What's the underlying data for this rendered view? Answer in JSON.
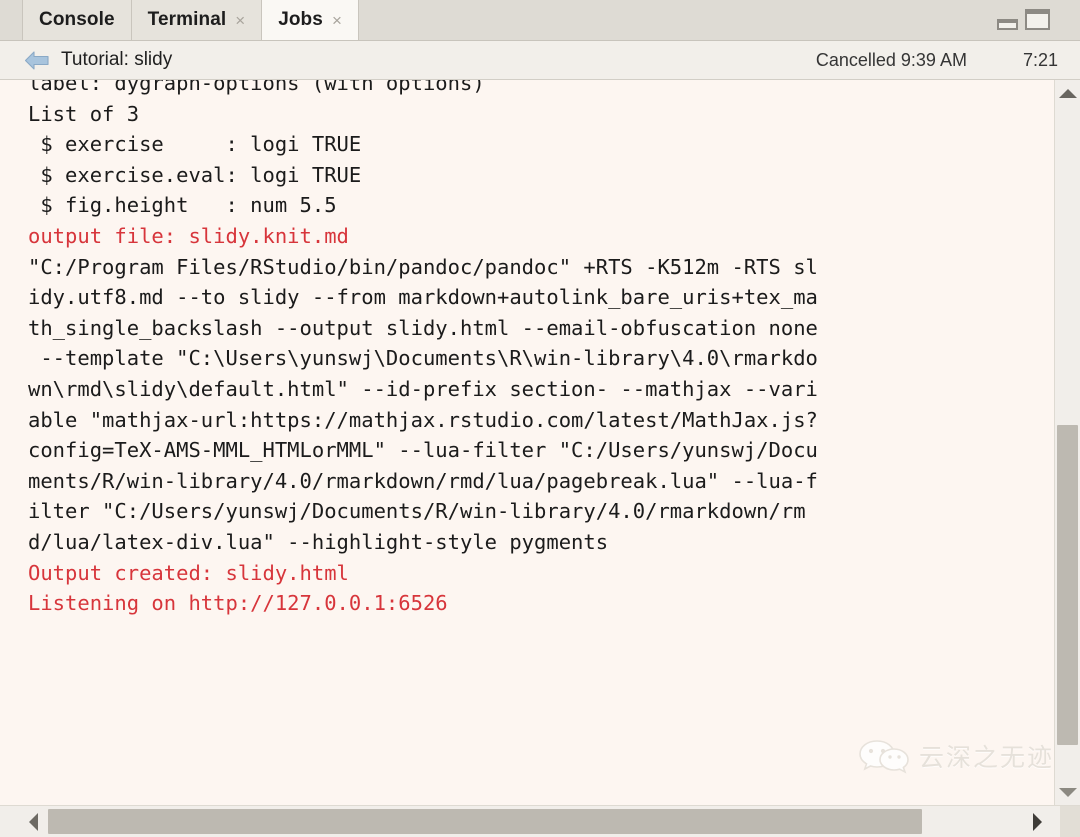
{
  "window": {
    "minimize_icon": "minimize-icon",
    "maximize_icon": "maximize-icon"
  },
  "tabs": [
    {
      "label": "Console",
      "closable": false,
      "active": false
    },
    {
      "label": "Terminal",
      "closable": true,
      "active": false,
      "close_glyph": "×"
    },
    {
      "label": "Jobs",
      "closable": true,
      "active": true,
      "close_glyph": "×"
    }
  ],
  "job_header": {
    "back_icon": "back-arrow-icon",
    "title": "Tutorial: slidy",
    "status": "Cancelled 9:39 AM",
    "elapsed": "7:21"
  },
  "console": {
    "lines": [
      {
        "text": "label: dygraph-options (with options)",
        "color": "default",
        "clipped": true
      },
      {
        "text": "List of 3",
        "color": "default"
      },
      {
        "text": " $ exercise     : logi TRUE",
        "color": "default"
      },
      {
        "text": " $ exercise.eval: logi TRUE",
        "color": "default"
      },
      {
        "text": " $ fig.height   : num 5.5",
        "color": "default"
      },
      {
        "text": "",
        "color": "default"
      },
      {
        "text": "",
        "color": "default"
      },
      {
        "text": "",
        "color": "default"
      },
      {
        "text": "output file: slidy.knit.md",
        "color": "red"
      },
      {
        "text": "",
        "color": "default"
      },
      {
        "text": "\"C:/Program Files/RStudio/bin/pandoc/pandoc\" +RTS -K512m -RTS sl",
        "color": "default"
      },
      {
        "text": "idy.utf8.md --to slidy --from markdown+autolink_bare_uris+tex_ma",
        "color": "default"
      },
      {
        "text": "th_single_backslash --output slidy.html --email-obfuscation none",
        "color": "default"
      },
      {
        "text": " --template \"C:\\Users\\yunswj\\Documents\\R\\win-library\\4.0\\rmarkdo",
        "color": "default"
      },
      {
        "text": "wn\\rmd\\slidy\\default.html\" --id-prefix section- --mathjax --vari",
        "color": "default"
      },
      {
        "text": "able \"mathjax-url:https://mathjax.rstudio.com/latest/MathJax.js?",
        "color": "default"
      },
      {
        "text": "config=TeX-AMS-MML_HTMLorMML\" --lua-filter \"C:/Users/yunswj/Docu",
        "color": "default"
      },
      {
        "text": "ments/R/win-library/4.0/rmarkdown/rmd/lua/pagebreak.lua\" --lua-f",
        "color": "default"
      },
      {
        "text": "ilter \"C:/Users/yunswj/Documents/R/win-library/4.0/rmarkdown/rm",
        "color": "default"
      },
      {
        "text": "d/lua/latex-div.lua\" --highlight-style pygments",
        "color": "default"
      },
      {
        "text": "",
        "color": "default"
      },
      {
        "text": "Output created: slidy.html",
        "color": "red"
      },
      {
        "text": "",
        "color": "default"
      },
      {
        "text": "Listening on http://127.0.0.1:6526",
        "color": "red"
      }
    ]
  },
  "scrollbars": {
    "vertical_up_icon": "scroll-up-arrow-icon",
    "vertical_down_icon": "scroll-down-arrow-icon",
    "horizontal_left_icon": "scroll-left-arrow-icon",
    "horizontal_right_icon": "scroll-right-arrow-icon"
  },
  "watermark": {
    "icon": "wechat-icon",
    "text": "云深之无迹"
  },
  "colors": {
    "console_background": "#fdf6f1",
    "console_text": "#1b1b1b",
    "console_red": "#d7353b",
    "tabbar_background": "#dedbd4",
    "active_tab": "#faf8f4",
    "scroll_thumb": "#bdb9b1"
  }
}
